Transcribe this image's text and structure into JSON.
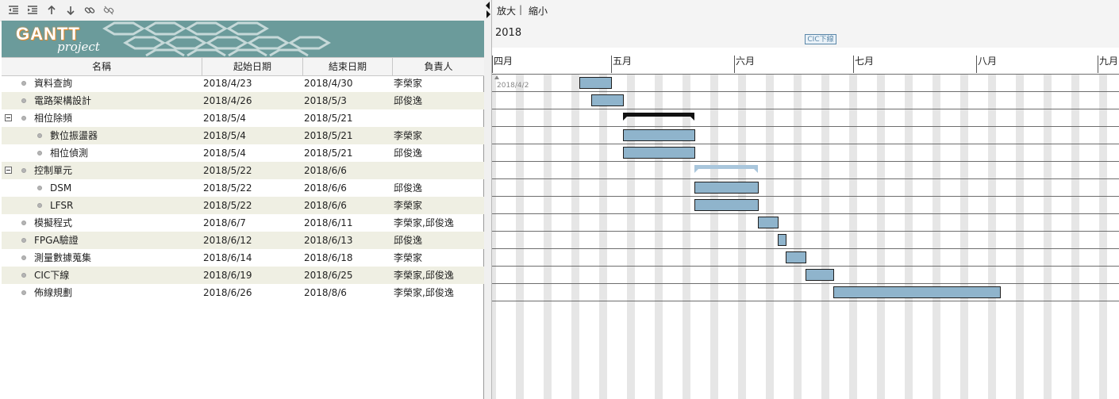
{
  "toolbar": {
    "buttons": [
      {
        "name": "unindent-icon"
      },
      {
        "name": "indent-icon"
      },
      {
        "name": "move-up-icon"
      },
      {
        "name": "move-down-icon"
      },
      {
        "name": "link-icon"
      },
      {
        "name": "unlink-icon"
      }
    ]
  },
  "logo": {
    "main": "GANTT",
    "sub": "project"
  },
  "columns": {
    "name": "名稱",
    "start": "起始日期",
    "end": "結束日期",
    "owner": "負責人"
  },
  "tasks": [
    {
      "name": "資料查詢",
      "start": "2018/4/23",
      "end": "2018/4/30",
      "owner": "李榮家",
      "level": 1,
      "group": false
    },
    {
      "name": "電路架構設計",
      "start": "2018/4/26",
      "end": "2018/5/3",
      "owner": "邱俊逸",
      "level": 1,
      "group": false
    },
    {
      "name": "相位除頻",
      "start": "2018/5/4",
      "end": "2018/5/21",
      "owner": "",
      "level": 1,
      "group": true
    },
    {
      "name": "數位振盪器",
      "start": "2018/5/4",
      "end": "2018/5/21",
      "owner": "李榮家",
      "level": 2,
      "group": false
    },
    {
      "name": "相位偵測",
      "start": "2018/5/4",
      "end": "2018/5/21",
      "owner": "邱俊逸",
      "level": 2,
      "group": false
    },
    {
      "name": "控制單元",
      "start": "2018/5/22",
      "end": "2018/6/6",
      "owner": "",
      "level": 1,
      "group": true
    },
    {
      "name": "DSM",
      "start": "2018/5/22",
      "end": "2018/6/6",
      "owner": "邱俊逸",
      "level": 2,
      "group": false
    },
    {
      "name": "LFSR",
      "start": "2018/5/22",
      "end": "2018/6/6",
      "owner": "李榮家",
      "level": 2,
      "group": false
    },
    {
      "name": "模擬程式",
      "start": "2018/6/7",
      "end": "2018/6/11",
      "owner": "李榮家,邱俊逸",
      "level": 1,
      "group": false
    },
    {
      "name": "FPGA驗證",
      "start": "2018/6/12",
      "end": "2018/6/13",
      "owner": "邱俊逸",
      "level": 1,
      "group": false
    },
    {
      "name": "測量數據蒐集",
      "start": "2018/6/14",
      "end": "2018/6/18",
      "owner": "李榮家",
      "level": 1,
      "group": false
    },
    {
      "name": "CIC下線",
      "start": "2018/6/19",
      "end": "2018/6/25",
      "owner": "李榮家,邱俊逸",
      "level": 1,
      "group": false
    },
    {
      "name": "佈線規劃",
      "start": "2018/6/26",
      "end": "2018/8/6",
      "owner": "李榮家,邱俊逸",
      "level": 1,
      "group": false
    }
  ],
  "timeline": {
    "zoom_in": "放大",
    "zoom_separator": "|",
    "zoom_out": "縮小",
    "year": "2018",
    "milestone_flag": "CIC下線",
    "date_marker": "2018/4/2",
    "months": [
      "四月",
      "五月",
      "六月",
      "七月",
      "八月",
      "九月"
    ],
    "colors": {
      "task": "#8fb4cc",
      "group_inactive": "#111111",
      "group_active": "#a9c6dc",
      "weekend": "#e6e6e6"
    }
  }
}
